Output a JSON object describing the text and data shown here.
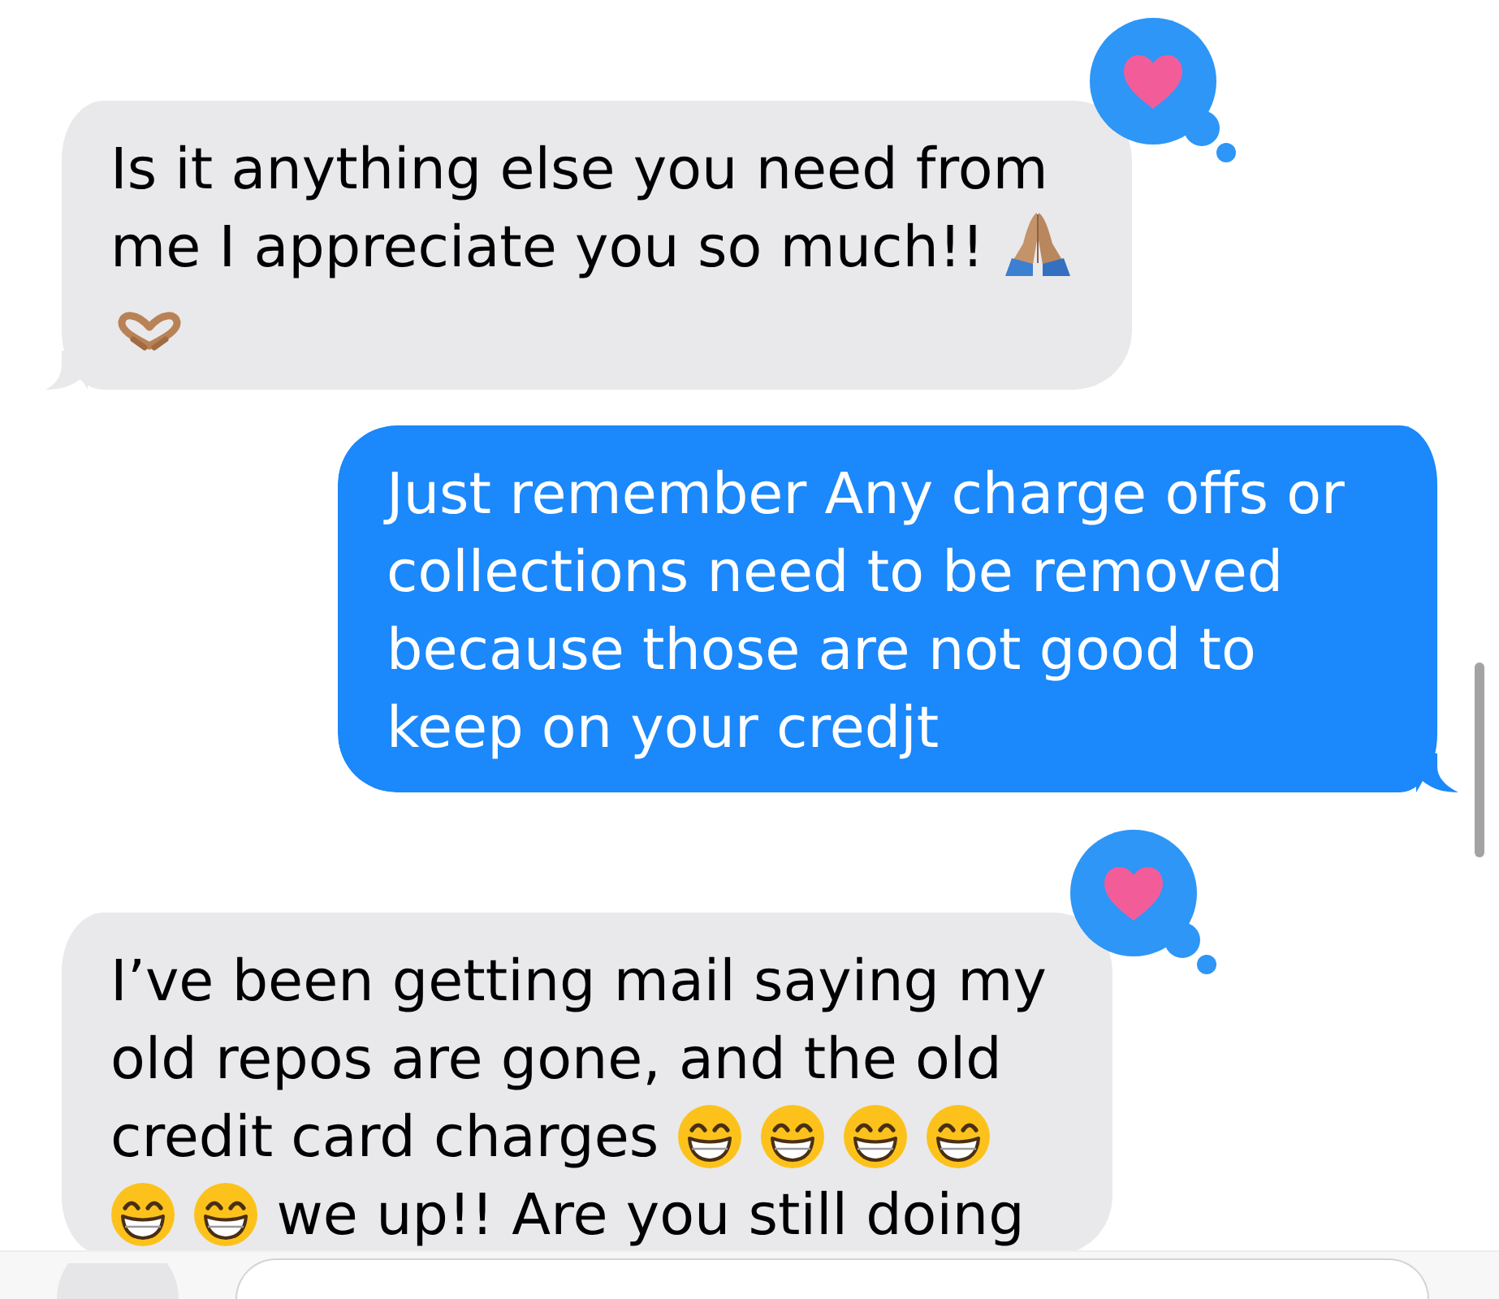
{
  "messages": [
    {
      "kind": "received",
      "loved": true,
      "parts": [
        {
          "kind": "text",
          "text": "Is it anything else you need from me I appreciate you so much!!"
        },
        {
          "kind": "pray"
        },
        {
          "kind": "heart-hands"
        }
      ]
    },
    {
      "kind": "sent",
      "loved": false,
      "parts": [
        {
          "kind": "text",
          "text": "Just remember Any charge offs or collections need to be removed because those are not good to keep on your credjt"
        }
      ]
    },
    {
      "kind": "received",
      "loved": true,
      "parts": [
        {
          "kind": "text",
          "text": "I’ve been getting mail saying my old repos are gone, and the old credit card charges"
        },
        {
          "kind": "grin"
        },
        {
          "kind": "grin"
        },
        {
          "kind": "grin"
        },
        {
          "kind": "grin"
        },
        {
          "kind": "grin"
        },
        {
          "kind": "grin"
        },
        {
          "kind": "text",
          "text": "we up!! Are you still doing"
        }
      ]
    }
  ]
}
